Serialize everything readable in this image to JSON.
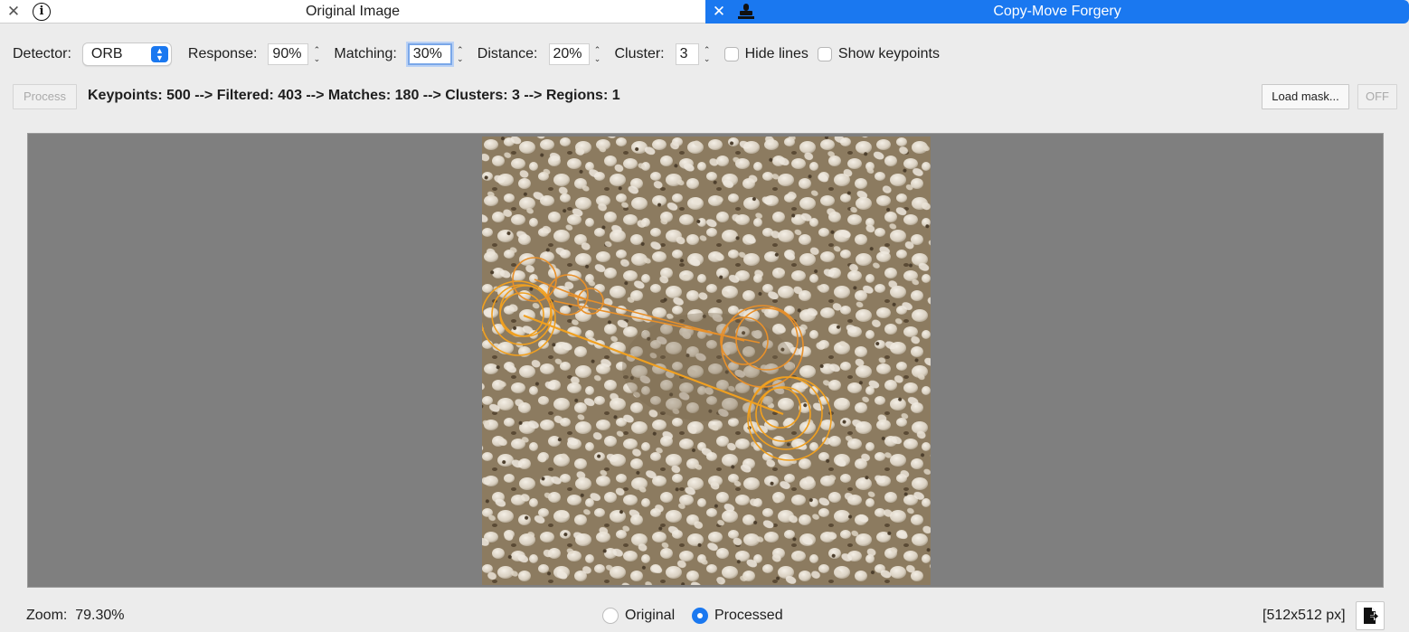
{
  "tabs": [
    {
      "title": "Original Image",
      "active": false,
      "icon": "info-icon"
    },
    {
      "title": "Copy-Move Forgery",
      "active": true,
      "icon": "stamp-icon"
    }
  ],
  "toolbar": {
    "detector_label": "Detector:",
    "detector_value": "ORB",
    "response_label": "Response:",
    "response_value": "90%",
    "matching_label": "Matching:",
    "matching_value": "30%",
    "distance_label": "Distance:",
    "distance_value": "20%",
    "cluster_label": "Cluster:",
    "cluster_value": "3",
    "hide_lines_label": "Hide lines",
    "show_keypoints_label": "Show keypoints"
  },
  "actions": {
    "process_label": "Process",
    "status_text": "Keypoints: 500 --> Filtered: 403 --> Matches: 180 --> Clusters: 3 --> Regions: 1",
    "load_mask_label": "Load mask...",
    "off_label": "OFF"
  },
  "footer": {
    "zoom_label": "Zoom:",
    "zoom_value": "79.30%",
    "view_original_label": "Original",
    "view_processed_label": "Processed",
    "selected_view": "Processed",
    "dimensions": "[512x512 px]"
  },
  "colors": {
    "accent": "#1a78f0",
    "overlay_orange": "#f0a020",
    "viewer_bg": "#7f7f7f"
  }
}
